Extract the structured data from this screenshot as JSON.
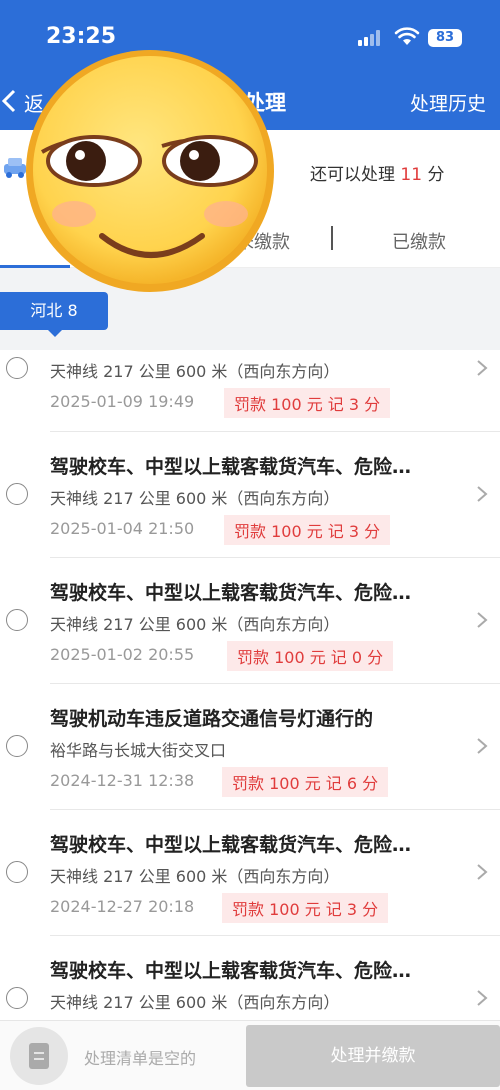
{
  "status_bar": {
    "time": "23:25",
    "battery": "83"
  },
  "header": {
    "back_label": "返",
    "title": "处理",
    "history": "处理历史"
  },
  "summary": {
    "prefix": "还可以处理 ",
    "points": "11",
    "suffix": " 分"
  },
  "tabs": {
    "unpaid": "未缴款",
    "paid": "已缴款"
  },
  "region_tag": "河北 8",
  "items": [
    {
      "title": "",
      "location": "天神线 217 公里 600 米（西向东方向）",
      "time": "2025-01-09 19:49",
      "penalty": "罚款 100 元  记 3 分"
    },
    {
      "title": "驾驶校车、中型以上载客载货汽车、危险…",
      "location": "天神线 217 公里 600 米（西向东方向）",
      "time": "2025-01-04 21:50",
      "penalty": "罚款 100 元  记 3 分"
    },
    {
      "title": "驾驶校车、中型以上载客载货汽车、危险…",
      "location": "天神线 217 公里 600 米（西向东方向）",
      "time": "2025-01-02 20:55",
      "penalty": "罚款 100 元  记 0 分"
    },
    {
      "title": "驾驶机动车违反道路交通信号灯通行的",
      "location": "裕华路与长城大街交叉口",
      "time": "2024-12-31 12:38",
      "penalty": "罚款 100 元  记 6 分"
    },
    {
      "title": "驾驶校车、中型以上载客载货汽车、危险…",
      "location": "天神线 217 公里 600 米（西向东方向）",
      "time": "2024-12-27 20:18",
      "penalty": "罚款 100 元  记 3 分"
    },
    {
      "title": "驾驶校车、中型以上载客载货汽车、危险…",
      "location": "天神线 217 公里 600 米（西向东方向）",
      "time": "",
      "penalty": ""
    }
  ],
  "bottom_bar": {
    "empty_text": "处理清单是空的",
    "button": "处理并缴款"
  },
  "colors": {
    "primary": "#2c6ed8",
    "penalty_red": "#e03c3c",
    "penalty_bg": "#fde9e9"
  },
  "icons": [
    "signal-icon",
    "wifi-icon",
    "battery-icon",
    "back-icon",
    "car-icon",
    "radio-icon",
    "chevron-right-icon",
    "list-icon",
    "smiling-face-emoji"
  ]
}
